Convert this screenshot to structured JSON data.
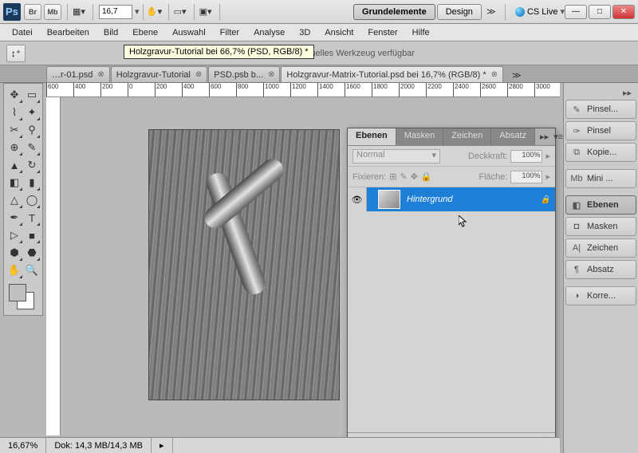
{
  "titlebar": {
    "logo": "Ps",
    "br": "Br",
    "mb": "Mb",
    "zoom": "16,7",
    "workspaces": {
      "grundelemente": "Grundelemente",
      "design": "Design"
    },
    "cs_live": "CS Live"
  },
  "menubar": [
    "Datei",
    "Bearbeiten",
    "Bild",
    "Ebene",
    "Auswahl",
    "Filter",
    "Analyse",
    "3D",
    "Ansicht",
    "Fenster",
    "Hilfe"
  ],
  "optbar": {
    "tooltip": "Holzgravur-Tutorial bei 66,7% (PSD, RGB/8) *",
    "message": "Keine Optionen für aktuelles Werkzeug verfügbar"
  },
  "doctabs": [
    {
      "label": "…r-01.psd",
      "active": false
    },
    {
      "label": "Holzgravur-Tutorial",
      "active": false
    },
    {
      "label": "PSD.psb b...",
      "active": false
    },
    {
      "label": "Holzgravur-Matrix-Tutorial.psd bei 16,7% (RGB/8) *",
      "active": true
    }
  ],
  "ruler_ticks": [
    600,
    400,
    200,
    0,
    200,
    400,
    600,
    800,
    1000,
    1200,
    1400,
    1600,
    1800,
    2000,
    2200,
    2400,
    2600,
    2800,
    3000
  ],
  "layers_panel": {
    "tabs": {
      "ebenen": "Ebenen",
      "masken": "Masken",
      "zeichen": "Zeichen",
      "absatz": "Absatz"
    },
    "blend_mode": "Normal",
    "opacity_label": "Deckkraft:",
    "opacity": "100%",
    "lock_label": "Fixieren:",
    "fill_label": "Fläche:",
    "fill": "100%",
    "layer_name": "Hintergrund"
  },
  "statusbar": {
    "zoom": "16,67%",
    "doc": "Dok: 14,3 MB/14,3 MB"
  },
  "right_dock": {
    "pinsel_dots": "Pinsel...",
    "pinsel": "Pinsel",
    "kopie": "Kopie...",
    "mini": "Mini ...",
    "ebenen": "Ebenen",
    "masken": "Masken",
    "zeichen": "Zeichen",
    "absatz": "Absatz",
    "korre": "Korre..."
  }
}
